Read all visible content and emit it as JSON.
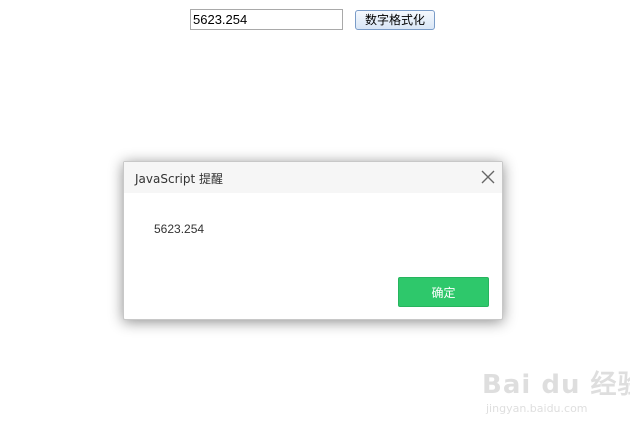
{
  "page": {
    "input_value": "5623.254",
    "format_button_label": "数字格式化"
  },
  "dialog": {
    "title": "JavaScript 提醒",
    "message": "5623.254",
    "ok_label": "确定",
    "close_icon": "close-icon",
    "accent_color": "#2ec86b"
  },
  "watermark": {
    "main": "Bai du 经验",
    "sub": "jingyan.baidu.com"
  }
}
